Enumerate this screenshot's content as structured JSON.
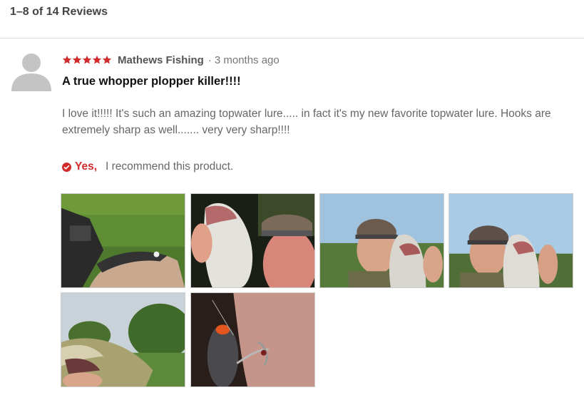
{
  "reviews_summary": {
    "count_text": "1–8 of 14 Reviews"
  },
  "review": {
    "rating": 5,
    "rating_max": 5,
    "star_color": "#d22b2b",
    "author": "Mathews Fishing",
    "separator": "·",
    "time_ago": "3 months ago",
    "title": "A true whopper plopper killer!!!!",
    "body": "I love it!!!!! It's such an amazing topwater lure..... in fact it's my new favorite topwater lure. Hooks are extremely sharp as well....... very very sharp!!!!",
    "recommend": {
      "yes_label": "Yes,",
      "text": "I recommend this product."
    },
    "photos": [
      {
        "icon": "fish-photo-grass"
      },
      {
        "icon": "fish-photo-person-night"
      },
      {
        "icon": "fish-photo-person-sky"
      },
      {
        "icon": "fish-photo-person-sky-2"
      },
      {
        "icon": "fish-photo-closeup-trees"
      },
      {
        "icon": "lure-photo-hook"
      }
    ]
  }
}
